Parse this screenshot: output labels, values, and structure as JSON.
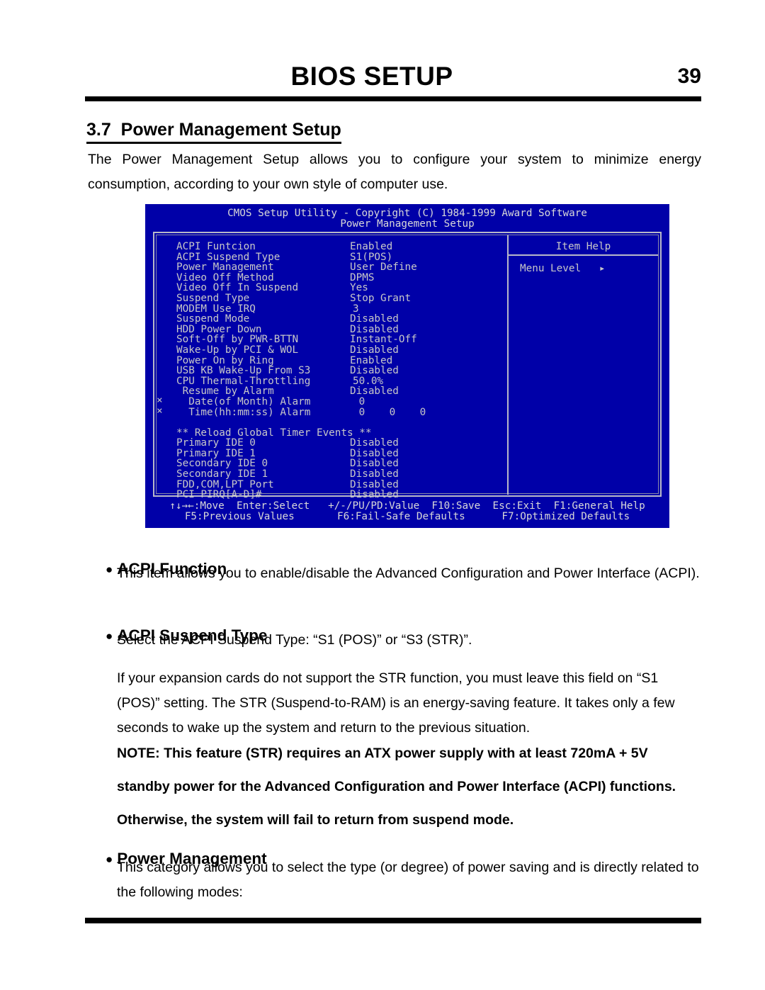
{
  "running_head": {
    "title": "BIOS SETUP",
    "page_number": "39"
  },
  "section": {
    "heading": "3.7  Power Management Setup",
    "intro": "The Power Management Setup allows you to configure your system to minimize energy consumption, according to your own style of computer use."
  },
  "bios": {
    "title": "CMOS Setup Utility - Copyright (C) 1984-1999 Award Software",
    "subtitle": "Power Management Setup",
    "help_title": "Item Help",
    "help_line": "Menu Level   ▸",
    "marks": [
      "×",
      "×"
    ],
    "rows": [
      {
        "label": "ACPI Funtcion",
        "value": "Enabled"
      },
      {
        "label": "ACPI Suspend Type",
        "value": "S1(POS)"
      },
      {
        "label": "Power Management",
        "value": "User Define"
      },
      {
        "label": "Video Off Method",
        "value": "DPMS"
      },
      {
        "label": "Video Off In Suspend",
        "value": "Yes"
      },
      {
        "label": "Suspend Type",
        "value": "Stop Grant"
      },
      {
        "label": "MODEM Use IRQ",
        "value": "3"
      },
      {
        "label": "Suspend Mode",
        "value": "Disabled"
      },
      {
        "label": "HDD Power Down",
        "value": "Disabled"
      },
      {
        "label": "Soft-Off by PWR-BTTN",
        "value": "Instant-Off"
      },
      {
        "label": "Wake-Up by PCI & WOL",
        "value": "Disabled"
      },
      {
        "label": "Power On by Ring",
        "value": "Enabled"
      },
      {
        "label": "USB KB Wake-Up From S3",
        "value": "Disabled"
      },
      {
        "label": "CPU Thermal-Throttling",
        "value": "50.0%"
      },
      {
        "label": " Resume by Alarm",
        "value": "Disabled"
      },
      {
        "label": "  Date(of Month) Alarm",
        "value": " 0"
      },
      {
        "label": "  Time(hh:mm:ss) Alarm",
        "value": " 0    0    0"
      },
      {
        "label": "",
        "value": ""
      },
      {
        "label": "** Reload Global Timer Events **",
        "value": ""
      },
      {
        "label": "Primary IDE 0",
        "value": "Disabled"
      },
      {
        "label": "Primary IDE 1",
        "value": "Disabled"
      },
      {
        "label": "Secondary IDE 0",
        "value": "Disabled"
      },
      {
        "label": "Secondary IDE 1",
        "value": "Disabled"
      },
      {
        "label": "FDD,COM,LPT Port",
        "value": "Disabled"
      },
      {
        "label": "PCI PIRQ[A-D]#",
        "value": "Disabled"
      }
    ],
    "footer_line1": "↑↓→←:Move  Enter:Select   +/-/PU/PD:Value  F10:Save  Esc:Exit  F1:General Help",
    "footer_line2": "F5:Previous Values       F6:Fail-Safe Defaults      F7:Optimized Defaults"
  },
  "items": {
    "acpi_function": {
      "heading": "ACPI Function",
      "body": "This item allows you to enable/disable the Advanced Configuration and Power Interface (ACPI)."
    },
    "acpi_suspend_type": {
      "heading": "ACPI Suspend Type",
      "body1": "Select the ACPI Suspend Type: “S1 (POS)” or “S3 (STR)”.",
      "body2": "If your expansion cards do not support the STR function, you must leave this field on “S1 (POS)” setting.  The STR (Suspend-to-RAM) is an energy-saving feature.  It takes only a few seconds to wake up the system and return to the previous situation.",
      "note_line1": "NOTE:  This feature (STR) requires an ATX power supply with at least 720mA + 5V",
      "note_line2": "standby power for the Advanced Configuration and Power Interface (ACPI) functions.",
      "note_line3": "Otherwise, the system will fail to return from suspend mode."
    },
    "power_management": {
      "heading": "Power Management",
      "body": "This category allows you to select the type (or degree) of power saving and is directly related to the following modes:"
    }
  }
}
